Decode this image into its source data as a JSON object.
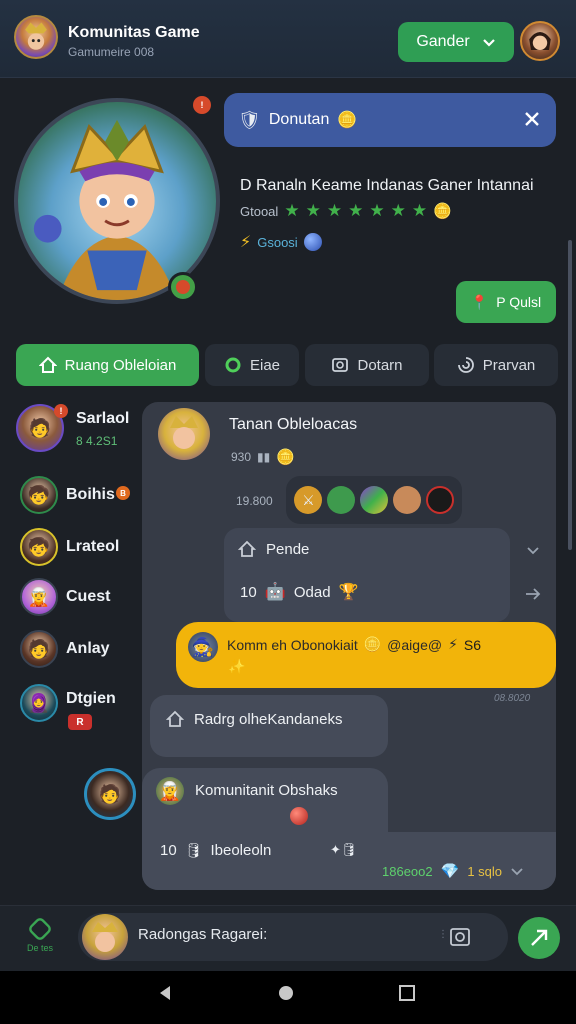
{
  "header": {
    "title": "Komunitas Game",
    "subtitle": "Gamumeire 008",
    "gender_button": "Gander"
  },
  "hero": {
    "donation_label": "Donutan",
    "headline": "D Ranaln Keame Indanas Ganer Intannai",
    "rating_label": "Gtooal",
    "stars": [
      "★",
      "★",
      "★",
      "★",
      "★",
      "★",
      "★"
    ],
    "status_label": "Gsoosi",
    "pill_label": "P Qulsl"
  },
  "tabs": [
    {
      "label": "Ruang Obleloian",
      "icon": "home-icon"
    },
    {
      "label": "Eiae",
      "icon": "ring-icon"
    },
    {
      "label": "Dotarn",
      "icon": "picture-icon"
    },
    {
      "label": "Prarvan",
      "icon": "swirl-icon"
    }
  ],
  "sidebar": {
    "users": [
      {
        "name": "Sarlaol",
        "meta": "8 4.2S1",
        "badge": "!"
      },
      {
        "name": "Boihis",
        "meta": "",
        "badge": "B"
      },
      {
        "name": "Lrateol",
        "meta": "",
        "badge": ""
      },
      {
        "name": "Cuest",
        "meta": "",
        "badge": ""
      },
      {
        "name": "Anlay",
        "meta": "",
        "badge": ""
      },
      {
        "name": "Dtgien",
        "meta": "",
        "badge": "R"
      }
    ]
  },
  "chat": {
    "card_title": "Tanan Obleloacas",
    "card_meta": "930",
    "row_time": "19.800",
    "pende_title": "Pende",
    "pende_meta_num": "10",
    "pende_meta_text": "Odad",
    "highlight_text": "Komm eh Obonokiait",
    "highlight_suffix": "@aige@",
    "highlight_end": "S6",
    "highlight_time": "08.8020",
    "reply_text": "Radrg olheKandaneks",
    "bottom_title": "Komunitanit Obshaks",
    "bottom_num": "10",
    "bottom_text": "Ibeoleoln",
    "bottom_status": "186eoo2",
    "bottom_count": "1 sqlo"
  },
  "composer": {
    "left_label": "De tes",
    "placeholder": "Radongas Ragarei:"
  },
  "colors": {
    "accent_green": "#3aa653",
    "highlight_yellow": "#f2b40a",
    "blue_banner": "#3e5aa0"
  }
}
